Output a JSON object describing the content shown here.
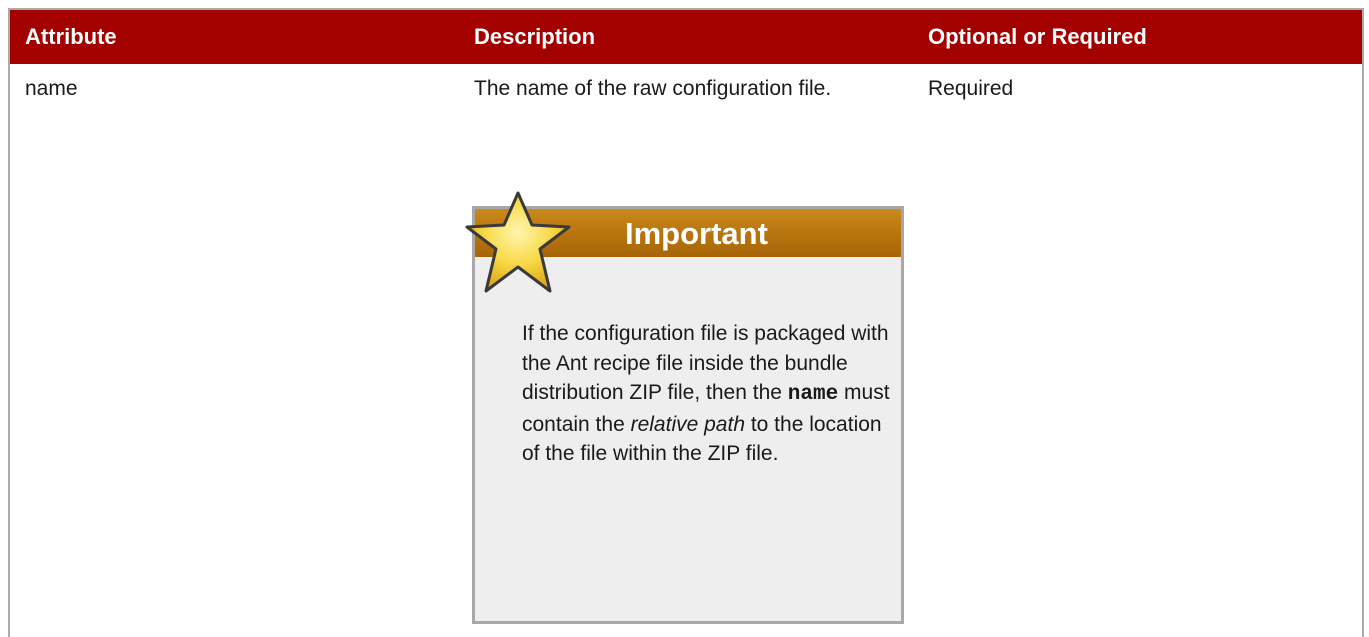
{
  "table": {
    "headers": {
      "attribute": "Attribute",
      "description": "Description",
      "optional_or_required": "Optional or Required"
    },
    "rows": [
      {
        "attribute": "name",
        "description": "The name of the raw configuration file.",
        "optional_or_required": "Required"
      }
    ]
  },
  "admonition": {
    "icon": "star-icon",
    "title": "Important",
    "body": {
      "part1": "If the configuration file is packaged with the Ant recipe file inside the bundle distribution ZIP file, then the ",
      "code": "name",
      "part2": " must contain the ",
      "emphasis": "relative path",
      "part3": " to the location of the file within the ZIP file."
    }
  },
  "colors": {
    "header_bg": "#a30000",
    "admonition_bar": "#b5720e",
    "admonition_bg": "#eeeeee"
  }
}
